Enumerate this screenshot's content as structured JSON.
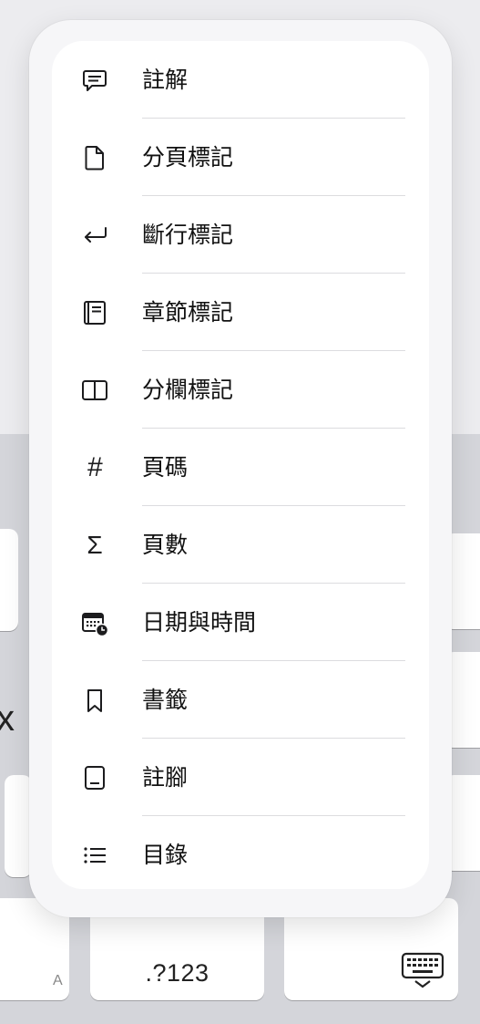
{
  "menu": {
    "items": [
      {
        "label": "註解",
        "icon": "comment-icon"
      },
      {
        "label": "分頁標記",
        "icon": "page-break-icon"
      },
      {
        "label": "斷行標記",
        "icon": "line-break-icon"
      },
      {
        "label": "章節標記",
        "icon": "section-break-icon"
      },
      {
        "label": "分欄標記",
        "icon": "column-break-icon"
      },
      {
        "label": "頁碼",
        "icon": "hash-icon",
        "glyph": "#"
      },
      {
        "label": "頁數",
        "icon": "sigma-icon",
        "glyph": "Σ"
      },
      {
        "label": "日期與時間",
        "icon": "calendar-clock-icon"
      },
      {
        "label": "書籤",
        "icon": "bookmark-icon"
      },
      {
        "label": "註腳",
        "icon": "footnote-icon"
      },
      {
        "label": "目錄",
        "icon": "list-icon"
      }
    ]
  },
  "keyboard": {
    "numbers_key_label": ".?123",
    "partial_key_char": "x",
    "partial_key_hint": "A"
  }
}
